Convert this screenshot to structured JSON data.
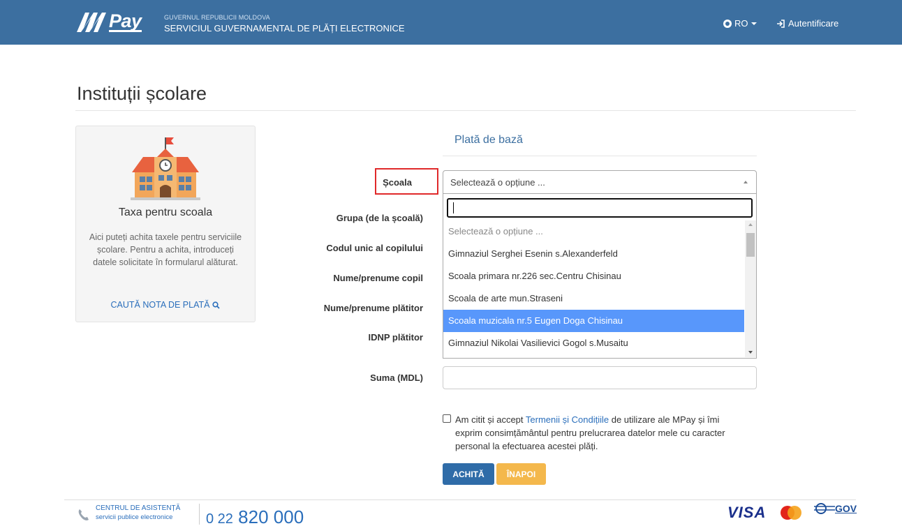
{
  "header": {
    "logo_text": "Pay",
    "gov_line1": "GUVERNUL REPUBLICII MOLDOVA",
    "gov_line2": "SERVICIUL GUVERNAMENTAL DE PLĂȚI ELECTRONICE",
    "language": "RO",
    "login_label": "Autentificare"
  },
  "page": {
    "title": "Instituții școlare"
  },
  "info_card": {
    "title": "Taxa pentru scoala",
    "description": "Aici puteți achita taxele pentru serviciile școlare. Pentru a achita, introduceți datele solicitate în formularul alăturat.",
    "link_label": "CAUTĂ NOTA DE PLATĂ"
  },
  "form": {
    "section_title": "Plată de bază",
    "labels": {
      "school": "Școala",
      "group": "Grupa (de la școală)",
      "child_code": "Codul unic al copilului",
      "child_name": "Nume/prenume copil",
      "payer_name": "Nume/prenume plătitor",
      "payer_idnp": "IDNP plătitor",
      "amount": "Suma (MDL)"
    },
    "school_select": {
      "selected": "Selectează o opțiune ...",
      "search_value": "",
      "options": [
        "Selectează o opțiune ...",
        "Gimnaziul Serghei Esenin s.Alexanderfeld",
        "Scoala primara nr.226 sec.Centru Chisinau",
        "Scoala de arte mun.Straseni",
        "Scoala muzicala nr.5 Eugen Doga Chisinau",
        "Gimnaziul Nikolai Vasilievici Gogol s.Musaitu"
      ],
      "highlighted_option": "Scoala muzicala nr.5 Eugen Doga Chisinau"
    },
    "amount_value": "",
    "terms": {
      "checked": false,
      "text_before": "Am citit și accept ",
      "link": "Termenii și Condițiile",
      "text_after": " de utilizare ale MPay și îmi exprim consimțământul pentru prelucrarea datelor mele cu caracter personal la efectuarea acestei plăți."
    },
    "pay_button": "ACHITĂ",
    "back_button": "ÎNAPOI"
  },
  "footer": {
    "help_title": "CENTRUL DE ASISTENȚĂ",
    "help_subtitle": "servicii publice electronice",
    "phone_prefix": "0 22",
    "phone_number": "820 000",
    "payment_logos": [
      "VISA",
      "MasterCard",
      "GOV"
    ]
  },
  "colors": {
    "navbar": "#3c6fa0",
    "primary": "#2f6ca8",
    "warning": "#f4b84c",
    "highlight_option": "#5897fb",
    "annotation_box": "#e0292a",
    "link": "#2a6ebb"
  }
}
